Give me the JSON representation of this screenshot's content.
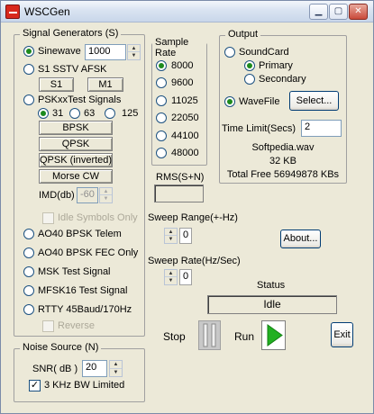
{
  "window": {
    "title": "WSCGen"
  },
  "signal_generators": {
    "label": "Signal Generators (S)",
    "sinewave": {
      "label": "Sinewave",
      "value": "1000",
      "selected": true
    },
    "sstv": {
      "label": "S1  SSTV AFSK",
      "s1": "S1",
      "m1": "M1"
    },
    "psk": {
      "label": "PSKxxTest Signals",
      "rates": [
        "31",
        "63",
        "125"
      ],
      "selected_rate": "31",
      "buttons": [
        "BPSK",
        "QPSK",
        "QPSK (inverted)",
        "Morse CW"
      ]
    },
    "imd": {
      "label": "IMD(db)",
      "value": "-60"
    },
    "idle_only": "Idle Symbols Only",
    "modes": [
      "AO40 BPSK Telem",
      "AO40 BPSK FEC Only",
      "MSK Test Signal",
      "MFSK16 Test Signal",
      "RTTY 45Baud/170Hz"
    ],
    "reverse": "Reverse"
  },
  "noise_source": {
    "label": "Noise Source (N)",
    "snr_label": "SNR( dB )",
    "snr_value": "20",
    "bw_limited": "3 KHz BW Limited",
    "bw_checked": true
  },
  "sample_rate": {
    "label": "Sample Rate",
    "options": [
      "8000",
      "9600",
      "11025",
      "22050",
      "44100",
      "48000"
    ],
    "selected": "8000"
  },
  "output": {
    "label": "Output",
    "soundcard": "SoundCard",
    "primary": "Primary",
    "secondary": "Secondary",
    "wavefile": "WaveFile",
    "select_button": "Select...",
    "time_limit_label": "Time Limit(Secs)",
    "time_limit_value": "2",
    "filename": "Softpedia.wav",
    "size": "32 KB",
    "free": "Total Free 56949878 KBs"
  },
  "rms": {
    "label": "RMS(S+N)",
    "value": ""
  },
  "sweep_range": {
    "label": "Sweep Range(+-Hz)",
    "value": "0"
  },
  "sweep_rate": {
    "label": "Sweep Rate(Hz/Sec)",
    "value": "0"
  },
  "about_button": "About...",
  "status": {
    "label": "Status",
    "value": "Idle"
  },
  "controls": {
    "stop": "Stop",
    "run": "Run",
    "exit": "Exit"
  },
  "colors": {
    "run_green": "#22b022",
    "stop_gray": "#c8c8c8",
    "selected_dot": "#1d8a1d"
  }
}
